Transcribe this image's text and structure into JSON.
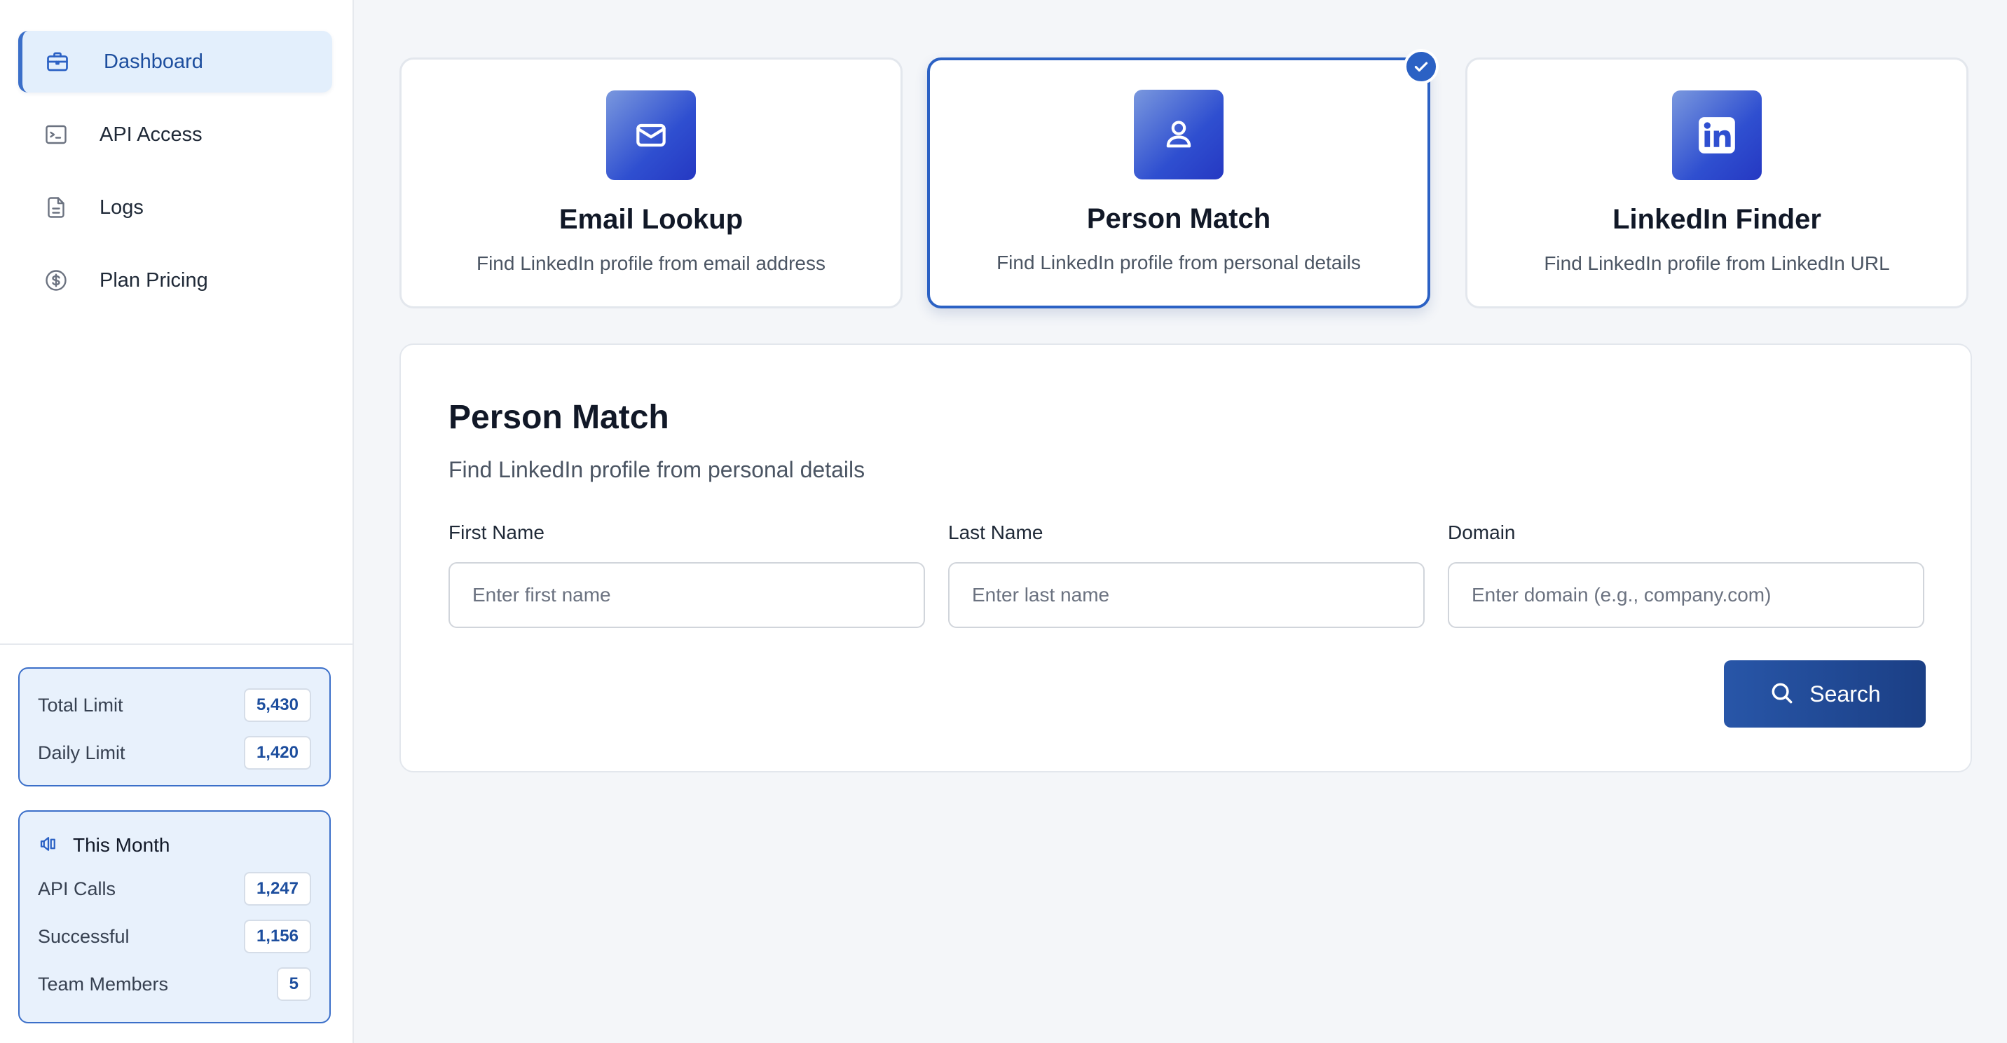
{
  "sidebar": {
    "nav": [
      {
        "label": "Dashboard",
        "icon": "briefcase-icon",
        "active": true
      },
      {
        "label": "API Access",
        "icon": "terminal-icon",
        "active": false
      },
      {
        "label": "Logs",
        "icon": "file-icon",
        "active": false
      },
      {
        "label": "Plan Pricing",
        "icon": "dollar-circle-icon",
        "active": false
      }
    ],
    "limits": [
      {
        "label": "Total Limit",
        "value": "5,430"
      },
      {
        "label": "Daily Limit",
        "value": "1,420"
      }
    ],
    "month": {
      "title": "This Month",
      "icon": "bar-chart-icon",
      "rows": [
        {
          "label": "API Calls",
          "value": "1,247"
        },
        {
          "label": "Successful",
          "value": "1,156"
        },
        {
          "label": "Team Members",
          "value": "5"
        }
      ]
    }
  },
  "cards": [
    {
      "title": "Email Lookup",
      "desc": "Find LinkedIn profile from email address",
      "icon": "mail-icon",
      "selected": false
    },
    {
      "title": "Person Match",
      "desc": "Find LinkedIn profile from personal details",
      "icon": "person-icon",
      "selected": true
    },
    {
      "title": "LinkedIn Finder",
      "desc": "Find LinkedIn profile from LinkedIn URL",
      "icon": "linkedin-icon",
      "selected": false
    }
  ],
  "form": {
    "title": "Person Match",
    "subtitle": "Find LinkedIn profile from personal details",
    "fields": [
      {
        "label": "First Name",
        "placeholder": "Enter first name",
        "value": ""
      },
      {
        "label": "Last Name",
        "placeholder": "Enter last name",
        "value": ""
      },
      {
        "label": "Domain",
        "placeholder": "Enter domain (e.g., company.com)",
        "value": ""
      }
    ],
    "search_label": "Search"
  },
  "colors": {
    "accent": "#2b61c4",
    "accent_dark": "#1b3f85",
    "active_nav_bg": "#e3effc",
    "stat_box_bg": "#e8f1fc"
  }
}
